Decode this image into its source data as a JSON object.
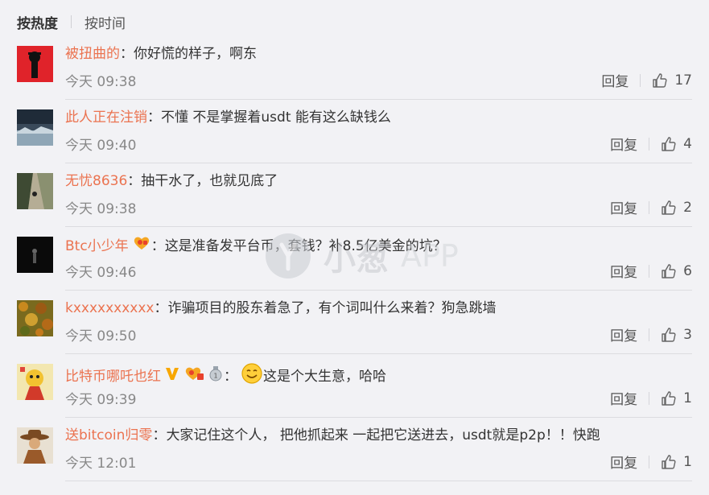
{
  "tabs": {
    "active": "按热度",
    "other": "按时间"
  },
  "watermark": {
    "cn": "小葱",
    "app": "APP"
  },
  "reply_label": "回复",
  "comments": [
    {
      "user": "被扭曲的",
      "text": "你好慌的样子，啊东",
      "time": "今天 09:38",
      "likes": "17",
      "avatar": "red-poster-avatar",
      "badges": []
    },
    {
      "user": "此人正在注销",
      "text": "不懂 不是掌握着usdt 能有这么缺钱么",
      "time": "今天 09:40",
      "likes": "4",
      "avatar": "landscape-avatar",
      "badges": []
    },
    {
      "user": "无忧8636",
      "text": "抽干水了，也就见底了",
      "time": "今天 09:38",
      "likes": "2",
      "avatar": "path-photo-avatar",
      "badges": []
    },
    {
      "user": "Btc小少年",
      "text": "这是准备发平台币，套钱？补8.5亿美金的坑？",
      "time": "今天 09:46",
      "likes": "6",
      "avatar": "dark-figure-avatar",
      "badges": [
        "fan-badge"
      ]
    },
    {
      "user": "kxxxxxxxxxx",
      "text": "诈骗项目的股东着急了，有个词叫什么来着？狗急跳墙",
      "time": "今天 09:50",
      "likes": "3",
      "avatar": "autumn-leaves-avatar",
      "badges": []
    },
    {
      "user": "比特币哪吒也红",
      "text": "这是个大生意，哈哈",
      "time": "今天 09:39",
      "likes": "1",
      "avatar": "cartoon-avatar",
      "badges": [
        "vip-v-badge",
        "fan-badge",
        "medal-badge"
      ],
      "emoji": "smile-emoji"
    },
    {
      "user": "送bitcoin归零",
      "text": "大家记住这个人， 把他抓起来 一起把它送进去，usdt就是p2p！！快跑",
      "time": "今天 12:01",
      "likes": "1",
      "avatar": "cowboy-avatar",
      "badges": []
    }
  ],
  "colors": {
    "username": "#eb7350",
    "background": "#f2f2f5",
    "divider": "#dcdce0"
  }
}
